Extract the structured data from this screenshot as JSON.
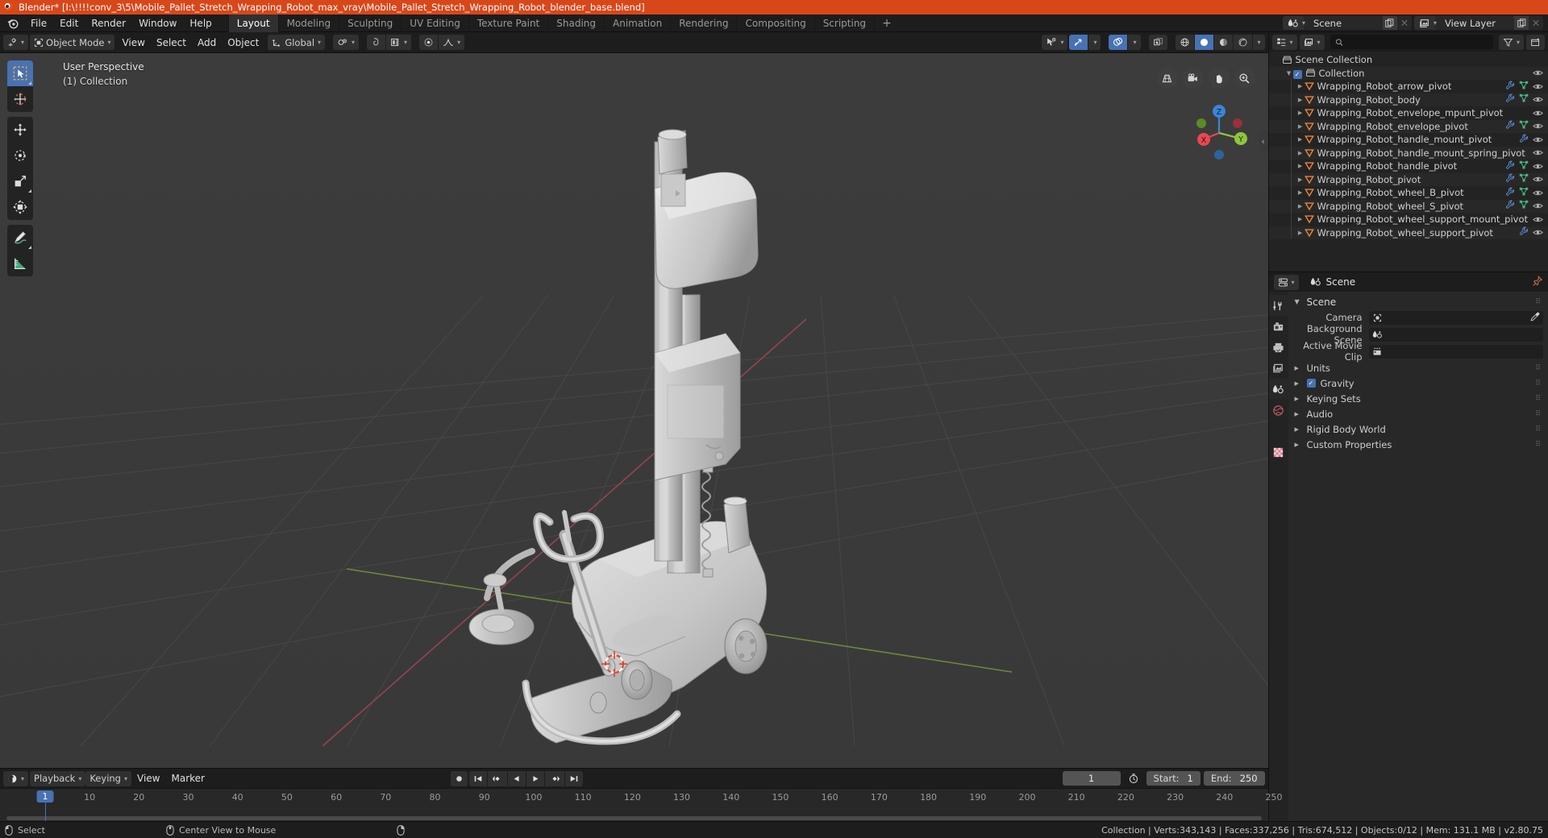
{
  "titlebar": {
    "text": "Blender* [I:\\!!!!conv_3\\5\\Mobile_Pallet_Stretch_Wrapping_Robot_max_vray\\Mobile_Pallet_Stretch_Wrapping_Robot_blender_base.blend]"
  },
  "topbar": {
    "menus": [
      "File",
      "Edit",
      "Render",
      "Window",
      "Help"
    ],
    "workspaces": [
      {
        "label": "Layout",
        "active": true
      },
      {
        "label": "Modeling",
        "active": false
      },
      {
        "label": "Sculpting",
        "active": false
      },
      {
        "label": "UV Editing",
        "active": false
      },
      {
        "label": "Texture Paint",
        "active": false
      },
      {
        "label": "Shading",
        "active": false
      },
      {
        "label": "Animation",
        "active": false
      },
      {
        "label": "Rendering",
        "active": false
      },
      {
        "label": "Compositing",
        "active": false
      },
      {
        "label": "Scripting",
        "active": false
      }
    ],
    "add_workspace": "+",
    "scene_name": "Scene",
    "view_layer_name": "View Layer"
  },
  "viewport_header": {
    "mode": "Object Mode",
    "menus": [
      "View",
      "Select",
      "Add",
      "Object"
    ],
    "orientation": "Global"
  },
  "viewport": {
    "perspective_label": "User Perspective",
    "collection_label": "(1) Collection",
    "gizmo_axes": {
      "x": "X",
      "y": "Y",
      "z": "Z"
    }
  },
  "outliner": {
    "search_placeholder": "",
    "rows": [
      {
        "label": "Scene Collection",
        "depth": 0,
        "type": "scene-collection",
        "has_disclosure": false,
        "has_checkbox": false,
        "modifier": false,
        "mesh": false,
        "eye": false
      },
      {
        "label": "Collection",
        "depth": 1,
        "type": "collection",
        "has_disclosure": true,
        "has_checkbox": true,
        "modifier": false,
        "mesh": false,
        "eye": true
      },
      {
        "label": "Wrapping_Robot_arrow_pivot",
        "depth": 2,
        "type": "object",
        "has_disclosure": true,
        "has_checkbox": false,
        "modifier": true,
        "mesh": true,
        "eye": true
      },
      {
        "label": "Wrapping_Robot_body",
        "depth": 2,
        "type": "object",
        "has_disclosure": true,
        "has_checkbox": false,
        "modifier": true,
        "mesh": true,
        "eye": true
      },
      {
        "label": "Wrapping_Robot_envelope_mpunt_pivot",
        "depth": 2,
        "type": "object",
        "has_disclosure": true,
        "has_checkbox": false,
        "modifier": false,
        "mesh": false,
        "eye": true
      },
      {
        "label": "Wrapping_Robot_envelope_pivot",
        "depth": 2,
        "type": "object",
        "has_disclosure": true,
        "has_checkbox": false,
        "modifier": true,
        "mesh": true,
        "eye": true
      },
      {
        "label": "Wrapping_Robot_handle_mount_pivot",
        "depth": 2,
        "type": "object",
        "has_disclosure": true,
        "has_checkbox": false,
        "modifier": true,
        "mesh": false,
        "eye": true
      },
      {
        "label": "Wrapping_Robot_handle_mount_spring_pivot",
        "depth": 2,
        "type": "object",
        "has_disclosure": true,
        "has_checkbox": false,
        "modifier": false,
        "mesh": false,
        "eye": true
      },
      {
        "label": "Wrapping_Robot_handle_pivot",
        "depth": 2,
        "type": "object",
        "has_disclosure": true,
        "has_checkbox": false,
        "modifier": true,
        "mesh": true,
        "eye": true
      },
      {
        "label": "Wrapping_Robot_pivot",
        "depth": 2,
        "type": "object",
        "has_disclosure": true,
        "has_checkbox": false,
        "modifier": true,
        "mesh": true,
        "eye": true
      },
      {
        "label": "Wrapping_Robot_wheel_B_pivot",
        "depth": 2,
        "type": "object",
        "has_disclosure": true,
        "has_checkbox": false,
        "modifier": true,
        "mesh": true,
        "eye": true
      },
      {
        "label": "Wrapping_Robot_wheel_S_pivot",
        "depth": 2,
        "type": "object",
        "has_disclosure": true,
        "has_checkbox": false,
        "modifier": true,
        "mesh": true,
        "eye": true
      },
      {
        "label": "Wrapping_Robot_wheel_support_mount_pivot",
        "depth": 2,
        "type": "object",
        "has_disclosure": true,
        "has_checkbox": false,
        "modifier": false,
        "mesh": false,
        "eye": true
      },
      {
        "label": "Wrapping_Robot_wheel_support_pivot",
        "depth": 2,
        "type": "object",
        "has_disclosure": true,
        "has_checkbox": false,
        "modifier": true,
        "mesh": false,
        "eye": true
      }
    ]
  },
  "properties": {
    "breadcrumb": "Scene",
    "panel_title": "Scene",
    "rows": [
      {
        "label": "Camera",
        "value": "",
        "icon": "camera-object-icon",
        "eyedropper": true
      },
      {
        "label": "Background Scene",
        "value": "",
        "icon": "scene-icon",
        "eyedropper": false
      },
      {
        "label": "Active Movie Clip",
        "value": "",
        "icon": "movieclip-icon",
        "eyedropper": false
      }
    ],
    "sections": [
      {
        "label": "Units",
        "checkbox": false,
        "checked": false
      },
      {
        "label": "Gravity",
        "checkbox": true,
        "checked": true
      },
      {
        "label": "Keying Sets",
        "checkbox": false,
        "checked": false
      },
      {
        "label": "Audio",
        "checkbox": false,
        "checked": false
      },
      {
        "label": "Rigid Body World",
        "checkbox": false,
        "checked": false
      },
      {
        "label": "Custom Properties",
        "checkbox": false,
        "checked": false
      }
    ]
  },
  "timeline": {
    "menus": [
      "Playback",
      "Keying",
      "View",
      "Marker"
    ],
    "current_frame": "1",
    "start_label": "Start:",
    "start_value": "1",
    "end_label": "End:",
    "end_value": "250",
    "ticks": [
      "10",
      "20",
      "30",
      "40",
      "50",
      "60",
      "70",
      "80",
      "90",
      "100",
      "110",
      "120",
      "130",
      "140",
      "150",
      "160",
      "170",
      "180",
      "190",
      "200",
      "210",
      "220",
      "230",
      "240",
      "250"
    ],
    "playhead_label": "1"
  },
  "statusbar": {
    "left_items": [
      "Select",
      "Center View to Mouse"
    ],
    "stats": "Collection | Verts:343,143 | Faces:337,256 | Tris:674,512 | Objects:0/12 | Mem: 131.1 MB | v2.80.75"
  },
  "colors": {
    "accent": "#4772b3",
    "title_bar": "#d8471a",
    "axis_x": "#e8484f",
    "axis_y": "#8ec63f",
    "axis_z": "#3a86d8",
    "object_orange": "#e8833a",
    "mesh_green": "#4bc98a",
    "modifier_blue": "#5a8ad0"
  }
}
